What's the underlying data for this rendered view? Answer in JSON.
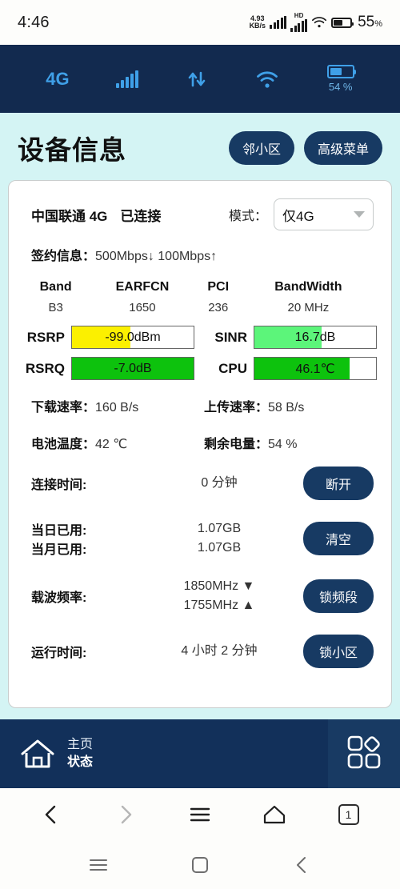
{
  "status_bar": {
    "time": "4:46",
    "net_speed_value": "4.93",
    "net_speed_unit": "KB/s",
    "hd_tag": "HD",
    "battery_percent": "55",
    "percent_symbol": "%"
  },
  "signal_strip": {
    "network_type": "4G",
    "battery_label": "54 %",
    "battery_fill_percent": 54
  },
  "header": {
    "title": "设备信息",
    "buttons": [
      {
        "label": "邻小区"
      },
      {
        "label": "高级菜单"
      }
    ]
  },
  "connection": {
    "carrier": "中国联通 4G",
    "state": "已连接",
    "mode_label": "模式：",
    "mode_value": "仅4G",
    "plan_label": "签约信息：",
    "plan_value": "500Mbps↓  100Mbps↑"
  },
  "band_table": {
    "headers": [
      "Band",
      "EARFCN",
      "PCI",
      "BandWidth"
    ],
    "values": [
      "B3",
      "1650",
      "236",
      "20 MHz"
    ]
  },
  "gauges": [
    {
      "label": "RSRP",
      "value": "-99.0dBm",
      "fill_percent": 48,
      "color": "#fbf000"
    },
    {
      "label": "SINR",
      "value": "16.7dB",
      "fill_percent": 55,
      "color": "#5cf57a"
    },
    {
      "label": "RSRQ",
      "value": "-7.0dB",
      "fill_percent": 100,
      "color": "#0dc20d"
    },
    {
      "label": "CPU",
      "value": "46.1℃",
      "fill_percent": 78,
      "color": "#0dc20d"
    }
  ],
  "stats": [
    {
      "label": "下载速率：",
      "value": "160 B/s"
    },
    {
      "label": "上传速率：",
      "value": "58 B/s"
    },
    {
      "label": "电池温度：",
      "value": "42 ℃"
    },
    {
      "label": "剩余电量：",
      "value": "54 %"
    }
  ],
  "actions": {
    "connect_time_label": "连接时间:",
    "connect_time_value": "0 分钟",
    "disconnect_button": "断开",
    "today_label": "当日已用:",
    "today_value": "1.07GB",
    "month_label": "当月已用:",
    "month_value": "1.07GB",
    "clear_button": "清空",
    "carrier_freq_label": "载波频率:",
    "carrier_freq_dl": "1850MHz ▼",
    "carrier_freq_ul": "1755MHz ▲",
    "lock_band_button": "锁频段",
    "uptime_label": "运行时间:",
    "uptime_value": "4 小时 2 分钟",
    "lock_cell_button": "锁小区"
  },
  "app_nav": {
    "home_label": "主页",
    "status_label": "状态"
  },
  "browser_bar": {
    "tab_count": "1"
  },
  "colors": {
    "page_background": "#d4f4f4",
    "navy": "#173a63",
    "strip_navy": "#122a4f",
    "accent_blue": "#3fa0e8"
  }
}
